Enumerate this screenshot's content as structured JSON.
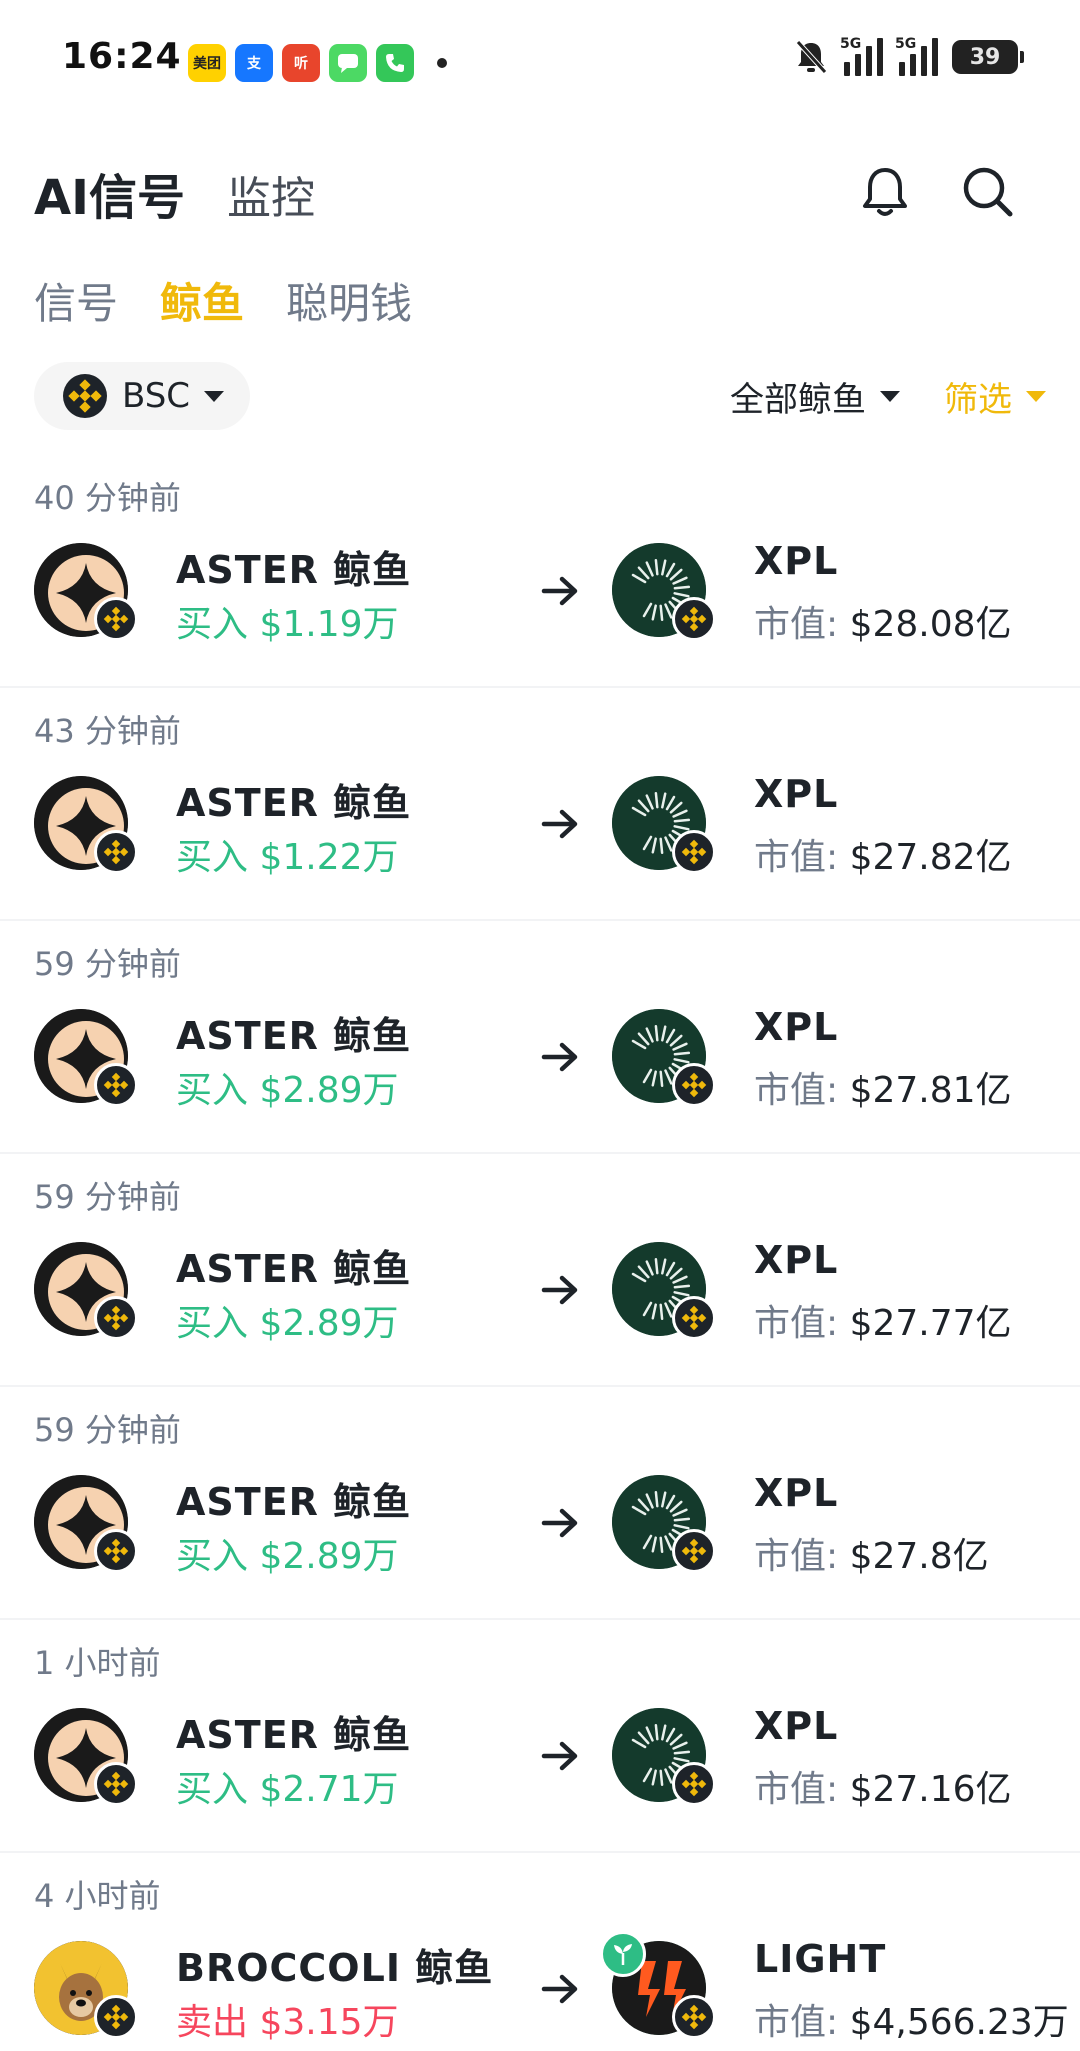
{
  "status_bar": {
    "time": "16:24",
    "apps": [
      {
        "name": "meituan",
        "label": "美团",
        "color": "#ffd100",
        "fg": "#222222"
      },
      {
        "name": "alipay",
        "label": "支",
        "color": "#1677ff",
        "fg": "#ffffff"
      },
      {
        "name": "ting",
        "label": "听",
        "color": "#e8452c",
        "fg": "#ffffff"
      },
      {
        "name": "messages",
        "label": "",
        "color": "#4cd964",
        "fg": "#ffffff"
      },
      {
        "name": "phone",
        "label": "",
        "color": "#34c759",
        "fg": "#ffffff"
      }
    ],
    "network_1": "5G",
    "network_2": "5G",
    "battery": "39"
  },
  "header": {
    "title": "AI信号",
    "secondary_tab": "监控",
    "bell_icon": "bell-icon",
    "search_icon": "search-icon"
  },
  "subtabs": [
    {
      "label": "信号",
      "active": false
    },
    {
      "label": "鲸鱼",
      "active": true
    },
    {
      "label": "聪明钱",
      "active": false
    }
  ],
  "filters": {
    "chain": "BSC",
    "whale_filter": "全部鲸鱼",
    "filter_label": "筛选"
  },
  "colors": {
    "accent": "#f0b90b",
    "buy": "#2ebd85",
    "sell": "#f6465d"
  },
  "rows": [
    {
      "time": "40 分钟前",
      "from_name": "ASTER 鲸鱼",
      "action": "买入",
      "amount": "$1.19万",
      "side": "buy",
      "to_name": "XPL",
      "cap_label": "市值:",
      "cap_value": "$28.08亿"
    },
    {
      "time": "43 分钟前",
      "from_name": "ASTER 鲸鱼",
      "action": "买入",
      "amount": "$1.22万",
      "side": "buy",
      "to_name": "XPL",
      "cap_label": "市值:",
      "cap_value": "$27.82亿"
    },
    {
      "time": "59 分钟前",
      "from_name": "ASTER 鲸鱼",
      "action": "买入",
      "amount": "$2.89万",
      "side": "buy",
      "to_name": "XPL",
      "cap_label": "市值:",
      "cap_value": "$27.81亿"
    },
    {
      "time": "59 分钟前",
      "from_name": "ASTER 鲸鱼",
      "action": "买入",
      "amount": "$2.89万",
      "side": "buy",
      "to_name": "XPL",
      "cap_label": "市值:",
      "cap_value": "$27.77亿"
    },
    {
      "time": "59 分钟前",
      "from_name": "ASTER 鲸鱼",
      "action": "买入",
      "amount": "$2.89万",
      "side": "buy",
      "to_name": "XPL",
      "cap_label": "市值:",
      "cap_value": "$27.8亿"
    },
    {
      "time": "1 小时前",
      "from_name": "ASTER 鲸鱼",
      "action": "买入",
      "amount": "$2.71万",
      "side": "buy",
      "to_name": "XPL",
      "cap_label": "市值:",
      "cap_value": "$27.16亿"
    },
    {
      "time": "4 小时前",
      "from_name": "BROCCOLI 鲸鱼",
      "action": "卖出",
      "amount": "$3.15万",
      "side": "sell",
      "to_name": "LIGHT",
      "cap_label": "市值:",
      "cap_value": "$4,566.23万"
    }
  ]
}
